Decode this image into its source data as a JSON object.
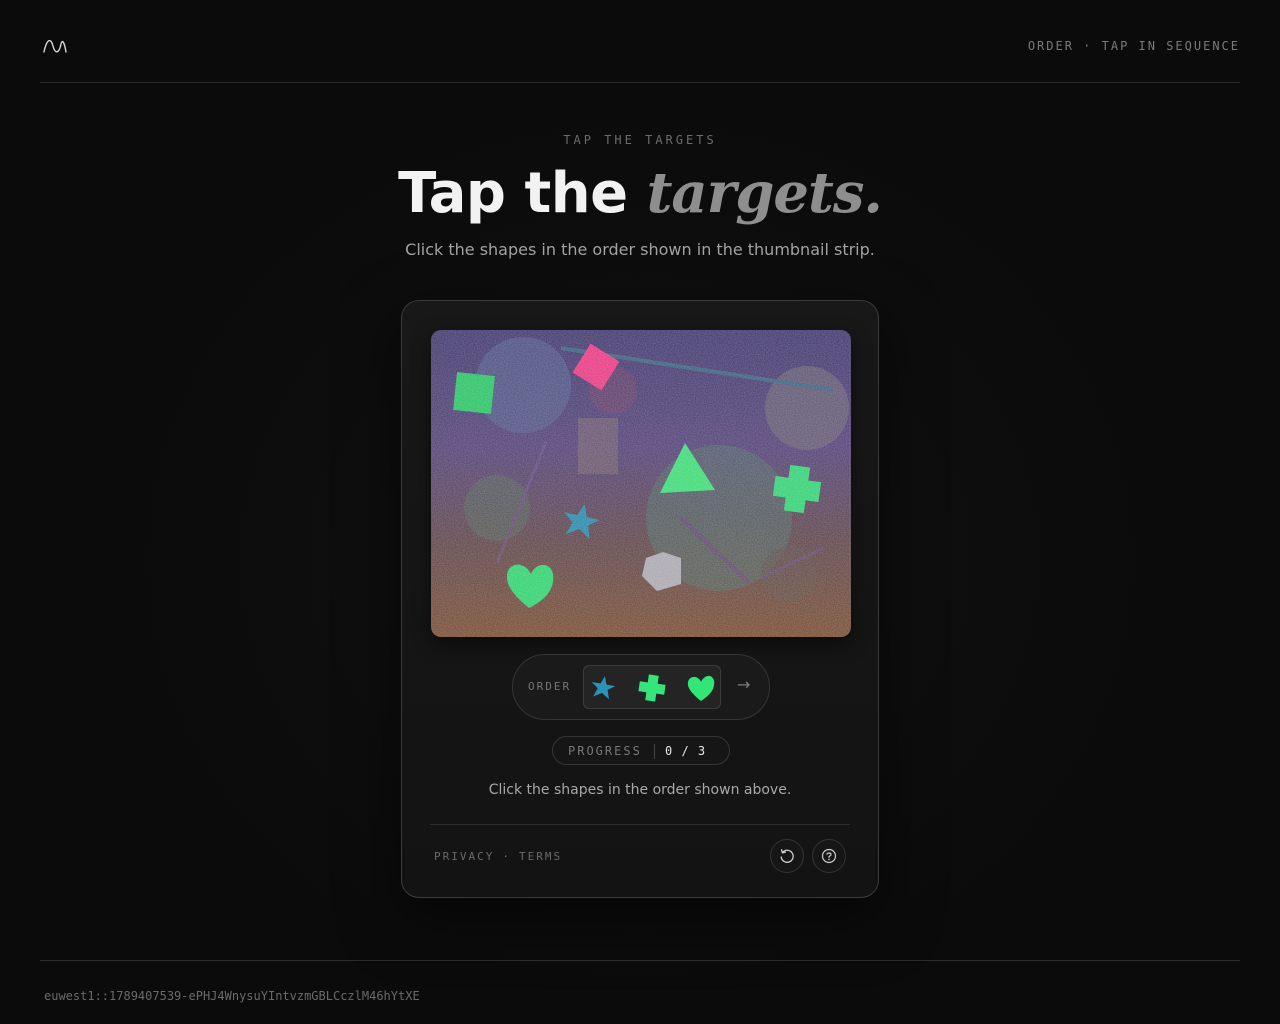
{
  "header": {
    "logo_icon": "wave-logo-icon",
    "meta_text": "ORDER · TAP IN SEQUENCE"
  },
  "hero": {
    "eyebrow": "TAP THE TARGETS",
    "title_plain": "Tap the",
    "title_accent": "targets.",
    "subtitle": "Click the shapes in the order shown in the thumbnail strip."
  },
  "challenge": {
    "canvas_shapes": [
      {
        "name": "green-square",
        "color": "#2bd46a"
      },
      {
        "name": "pink-diamond",
        "color": "#ff3a8a"
      },
      {
        "name": "green-triangle",
        "color": "#3ff07e"
      },
      {
        "name": "green-cross",
        "color": "#35e57c"
      },
      {
        "name": "blue-star",
        "color": "#2a93b8"
      },
      {
        "name": "green-heart",
        "color": "#32e676"
      },
      {
        "name": "gray-pentagon",
        "color": "#b9b6be"
      }
    ],
    "order": {
      "label": "ORDER",
      "sequence": [
        "star-icon",
        "cross-icon",
        "heart-icon"
      ],
      "arrow": "→"
    },
    "progress": {
      "label": "PROGRESS",
      "current": 0,
      "total": 3,
      "display": "0 / 3"
    },
    "instruction": "Click the shapes in the order shown above."
  },
  "card_footer": {
    "privacy_label": "PRIVACY",
    "separator": "·",
    "terms_label": "TERMS",
    "refresh_icon": "refresh-icon",
    "help_icon": "help-icon"
  },
  "footer": {
    "session_id": "euwest1::1789407539-ePHJ4WnysuYIntvzmGBLCczlM46hYtXE"
  },
  "colors": {
    "background": "#0c0c0c",
    "card_border": "#3a3a3a",
    "accent_green": "#35e57c"
  }
}
